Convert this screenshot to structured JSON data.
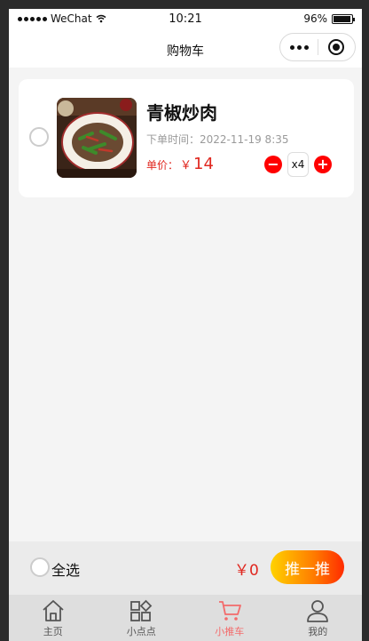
{
  "status_bar": {
    "carrier": "WeChat",
    "time": "10:21",
    "battery": "96%",
    "battery_level": 0.96
  },
  "navbar": {
    "title": "购物车"
  },
  "cart": {
    "items": [
      {
        "name": "青椒炒肉",
        "order_time": "下单时间：2022-11-19 8:35",
        "price_label": "单价：",
        "currency": "￥",
        "price": "14",
        "quantity": "x4",
        "minus": "−",
        "plus": "+"
      }
    ]
  },
  "checkout": {
    "select_all": "全选",
    "total": "￥0",
    "pay_button": "推一推"
  },
  "tabbar": {
    "tabs": [
      {
        "label": "主页",
        "icon": "home-icon"
      },
      {
        "label": "小点点",
        "icon": "apps-icon"
      },
      {
        "label": "小推车",
        "icon": "cart-icon",
        "active": true
      },
      {
        "label": "我的",
        "icon": "user-icon"
      }
    ]
  },
  "colors": {
    "accent": "#e0271f",
    "tab_active": "#f36b6b",
    "button_red": "#ff0000",
    "background": "#f4f4f4"
  }
}
